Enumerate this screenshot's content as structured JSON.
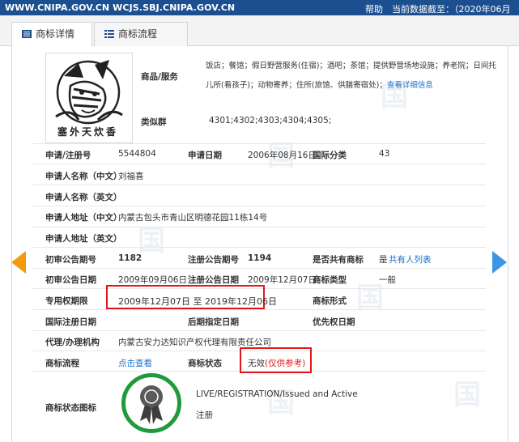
{
  "topbar": {
    "urls": "WWW.CNIPA.GOV.CN  WCJS.SBJ.CNIPA.GOV.CN",
    "help": "帮助",
    "data_as_of": "当前数据截至：（2020年06月16日）"
  },
  "tabs": [
    {
      "label": "商标详情",
      "active": true
    },
    {
      "label": "商标流程",
      "active": false
    }
  ],
  "trademark": {
    "goods_label": "商品/服务",
    "goods_line1": "饭店；餐馆；假日野营服务(住宿)；酒吧；茶馆；提供野营场地设施；养老院；日间托",
    "goods_line2": "儿所(看孩子)；动物寄养；住所(旅馆、供膳寄宿处)；",
    "goods_more_link": "查看详细信息",
    "similar_group_label": "类似群",
    "similar_group_value": "4301;4302;4303;4304;4305;",
    "logo_text": "塞外天炊香"
  },
  "fields": {
    "app_no_label": "申请/注册号",
    "app_no": "5544804",
    "app_date_label": "申请日期",
    "app_date": "2006年08月16日",
    "intl_class_label": "国际分类",
    "intl_class": "43",
    "applicant_cn_label": "申请人名称（中文）",
    "applicant_cn": "刘福喜",
    "applicant_en_label": "申请人名称（英文）",
    "applicant_en": "",
    "address_cn_label": "申请人地址（中文）",
    "address_cn": "内蒙古包头市青山区明德花园11栋14号",
    "address_en_label": "申请人地址（英文）",
    "address_en": "",
    "prelim_no_label": "初审公告期号",
    "prelim_no": "1182",
    "reg_no_label": "注册公告期号",
    "reg_no": "1194",
    "shared_label": "是否共有商标",
    "shared": "是",
    "shared_link": "共有人列表",
    "prelim_date_label": "初审公告日期",
    "prelim_date": "2009年09月06日",
    "reg_date_label": "注册公告日期",
    "reg_date": "2009年12月07日",
    "type_label": "商标类型",
    "type": "一般",
    "exclusive_label": "专用权期限",
    "exclusive": "2009年12月07日 至 2019年12月06日",
    "form_label": "商标形式",
    "form": "",
    "intl_reg_date_label": "国际注册日期",
    "intl_reg_date": "",
    "later_date_label": "后期指定日期",
    "later_date": "",
    "priority_label": "优先权日期",
    "priority": "",
    "agent_label": "代理/办理机构",
    "agent": "内蒙古安力达知识产权代理有限责任公司",
    "process_label": "商标流程",
    "process_link": "点击查看",
    "status_label": "商标状态",
    "status": "无效",
    "status_note": "(仅供参考)",
    "status_icon_label": "商标状态图标",
    "status_en": "LIVE/REGISTRATION/Issued and Active",
    "status_cn": "注册"
  },
  "colors": {
    "topbar": "#1c4f8f",
    "link": "#1a6fc9",
    "highlight": "#e2171c",
    "arrow_left": "#f39a0f",
    "arrow_right": "#3b97e3",
    "status_ring": "#1f9a3c"
  },
  "icons": {
    "tab1": "document-list-icon",
    "tab2": "flow-list-icon",
    "prev": "arrow-left-icon",
    "next": "arrow-right-icon",
    "status": "seal-ribbon-icon"
  }
}
